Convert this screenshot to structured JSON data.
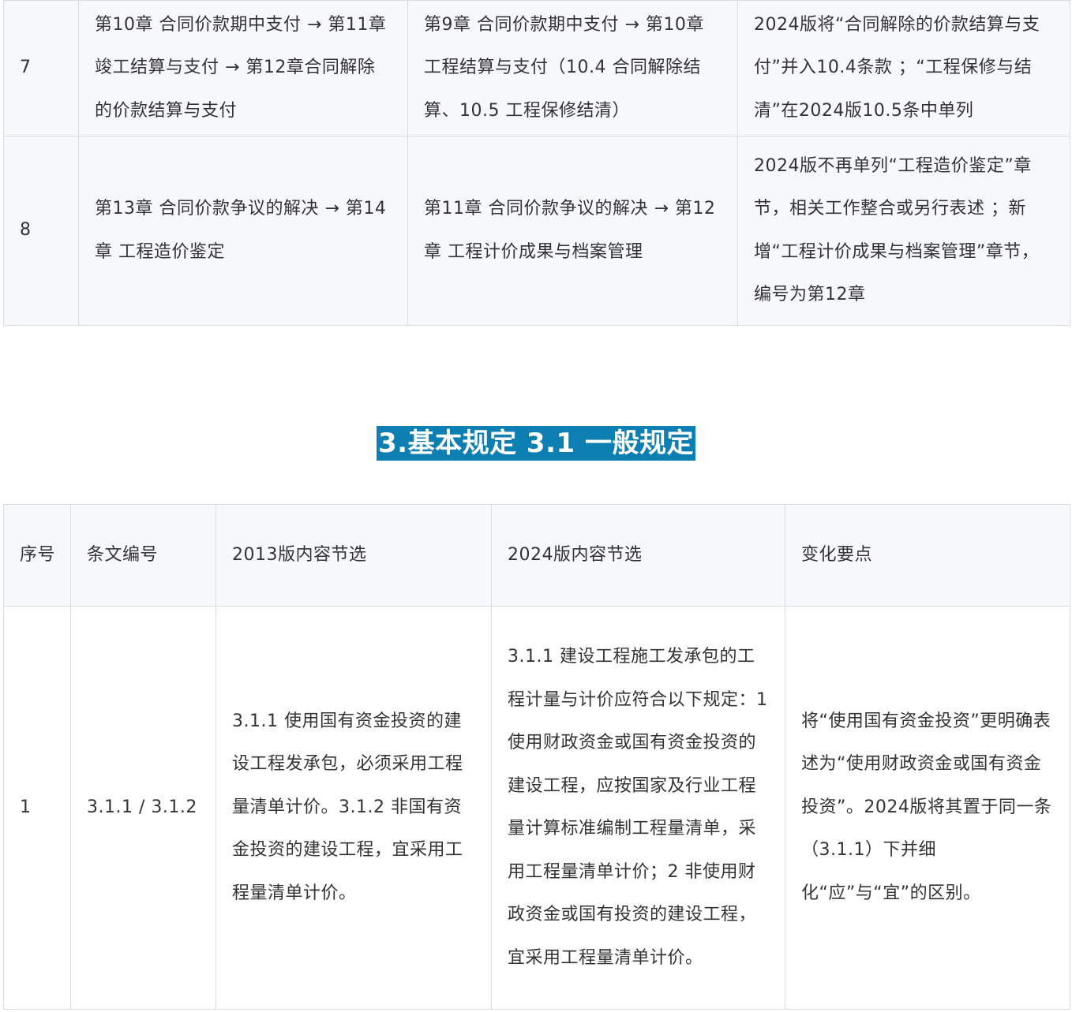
{
  "top_table": {
    "rows": [
      {
        "seq": "7",
        "col2": "第10章 合同价款期中支付 → 第11章 竣工结算与支付 → 第12章合同解除的价款结算与支付",
        "col3": "第9章 合同价款期中支付 → 第10章 工程结算与支付（10.4 合同解除结算、10.5 工程保修结清）",
        "col4": "2024版将“合同解除的价款结算与支付”并入10.4条款 ；“工程保修与结清”在2024版10.5条中单列"
      },
      {
        "seq": "8",
        "col2": "第13章 合同价款争议的解决 → 第14章 工程造价鉴定",
        "col3": "第11章 合同价款争议的解决 → 第12章 工程计价成果与档案管理",
        "col4": "2024版不再单列“工程造价鉴定”章节，相关工作整合或另行表述 ；新增“工程计价成果与档案管理”章节，编号为第12章"
      }
    ]
  },
  "section": {
    "heading": "3.基本规定  3.1 一般规定"
  },
  "bottom_table": {
    "headers": {
      "seq": "序号",
      "clause": "条文编号",
      "v2013": "2013版内容节选",
      "v2024": "2024版内容节选",
      "changes": "变化要点"
    },
    "rows": [
      {
        "seq": "1",
        "clause": "3.1.1 / 3.1.2",
        "v2013": "3.1.1 使用国有资金投资的建设工程发承包，必须采用工程量清单计价。3.1.2 非国有资金投资的建设工程，宜采用工程量清单计价。",
        "v2024": "3.1.1 建设工程施工发承包的工程计量与计价应符合以下规定：1 使用财政资金或国有资金投资的建设工程，应按国家及行业工程量计算标准编制工程量清单，采用工程量清单计价；2 非使用财政资金或国有投资的建设工程，宜采用工程量清单计价。",
        "changes": "将“使用国有资金投资”更明确表述为“使用财政资金或国有资金投资”。2024版将其置于同一条（3.1.1）下并细化“应”与“宜”的区别。"
      }
    ]
  }
}
